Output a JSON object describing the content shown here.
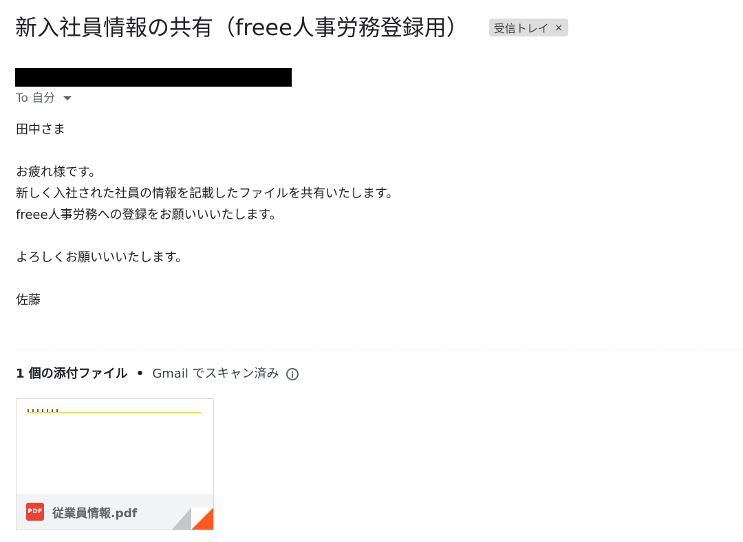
{
  "email": {
    "subject": "新入社員情報の共有（freee人事労務登録用）",
    "label_chip": "受信トレイ",
    "label_chip_close": "×",
    "recipient": "To 自分"
  },
  "body": {
    "lines": [
      "田中さま",
      "",
      "お疲れ様です。",
      "新しく入社された社員の情報を記載したファイルを共有いたします。",
      "freee人事労務への登録をお願いいいたします。",
      "",
      "よろしくお願いいいたします。",
      "",
      "佐藤"
    ]
  },
  "attachments": {
    "count_label": "1 個の添付ファイル",
    "separator": "•",
    "scan_label": "Gmail でスキャン済み",
    "files": [
      {
        "file_type": "PDF",
        "name": "従業員情報.pdf"
      }
    ]
  },
  "colors": {
    "pdf_icon": "#ea4335",
    "corner_fold": "#ff5722",
    "preview_highlight": "#f6e41c"
  }
}
